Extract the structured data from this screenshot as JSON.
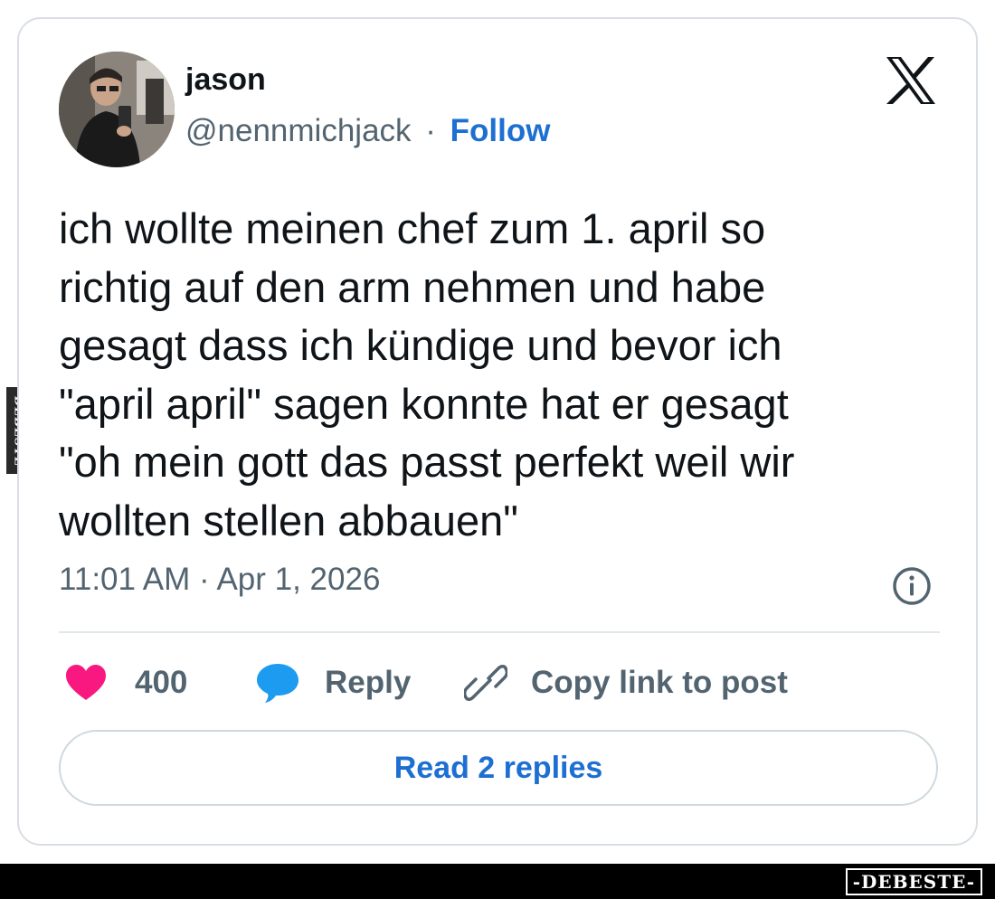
{
  "post": {
    "author": {
      "display_name": "jason",
      "handle": "@nennmichjack",
      "separator": "·",
      "follow_label": "Follow"
    },
    "platform_icon": "x-logo-icon",
    "text": "ich wollte meinen chef zum 1. april so\nrichtig auf den arm nehmen und habe\ngesagt dass ich kündige und bevor ich\n\"april april\" sagen konnte hat er gesagt\n\"oh mein gott das passt perfekt weil wir\nwollten stellen abbauen\"",
    "timestamp": "11:01 AM · Apr 1, 2026",
    "info_icon": "info-icon"
  },
  "actions": {
    "likes_count": "400",
    "reply_label": "Reply",
    "copy_link_label": "Copy link to post",
    "read_replies_label": "Read 2 replies"
  },
  "watermark": {
    "side_text": "DEBESTE",
    "logo_text": "-DEBESTE-"
  },
  "colors": {
    "accent_blue": "#1d6fd1",
    "heart_pink": "#f91880",
    "reply_blue": "#1d9bf0",
    "text_primary": "#0f1419",
    "text_secondary": "#536471",
    "border": "#d9dee3"
  }
}
